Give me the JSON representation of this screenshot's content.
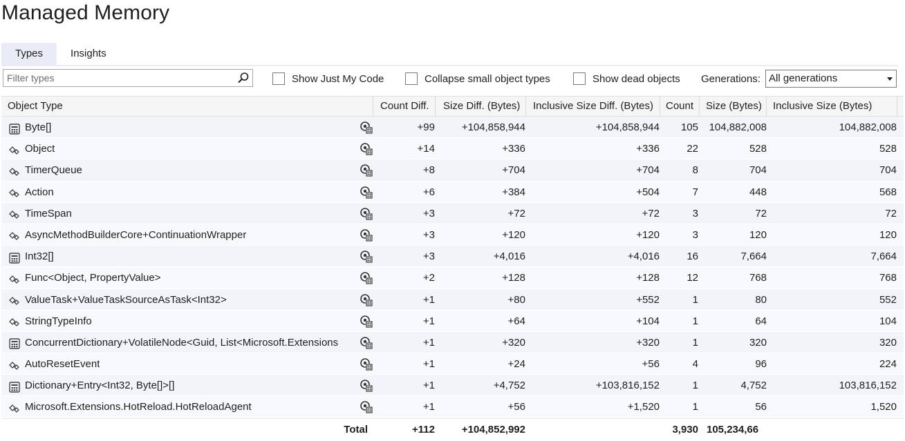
{
  "page": {
    "title": "Managed Memory"
  },
  "tabs": [
    {
      "label": "Types",
      "active": true
    },
    {
      "label": "Insights",
      "active": false
    }
  ],
  "toolbar": {
    "filter_placeholder": "Filter types",
    "filter_value": "",
    "show_just_my_code": {
      "label": "Show Just My Code",
      "checked": false
    },
    "collapse_small": {
      "label": "Collapse small object types",
      "checked": false
    },
    "show_dead": {
      "label": "Show dead objects",
      "checked": false
    },
    "generations_label": "Generations:",
    "generations_value": "All generations"
  },
  "table": {
    "columns": [
      "Object Type",
      "Count Diff.",
      "Size Diff. (Bytes)",
      "Inclusive Size Diff. (Bytes)",
      "Count",
      "Size (Bytes)",
      "Inclusive Size (Bytes)"
    ],
    "rows": [
      {
        "icon": "array-icon",
        "type": "Byte[]",
        "count_diff": "+99",
        "size_diff": "+104,858,944",
        "incl_size_diff": "+104,858,944",
        "count": "105",
        "size": "104,882,008",
        "incl_size": "104,882,008"
      },
      {
        "icon": "class-icon",
        "type": "Object",
        "count_diff": "+14",
        "size_diff": "+336",
        "incl_size_diff": "+336",
        "count": "22",
        "size": "528",
        "incl_size": "528"
      },
      {
        "icon": "class-icon",
        "type": "TimerQueue",
        "count_diff": "+8",
        "size_diff": "+704",
        "incl_size_diff": "+704",
        "count": "8",
        "size": "704",
        "incl_size": "704"
      },
      {
        "icon": "class-icon",
        "type": "Action",
        "count_diff": "+6",
        "size_diff": "+384",
        "incl_size_diff": "+504",
        "count": "7",
        "size": "448",
        "incl_size": "568"
      },
      {
        "icon": "class-icon",
        "type": "TimeSpan",
        "count_diff": "+3",
        "size_diff": "+72",
        "incl_size_diff": "+72",
        "count": "3",
        "size": "72",
        "incl_size": "72"
      },
      {
        "icon": "class-icon",
        "type": "AsyncMethodBuilderCore+ContinuationWrapper",
        "count_diff": "+3",
        "size_diff": "+120",
        "incl_size_diff": "+120",
        "count": "3",
        "size": "120",
        "incl_size": "120"
      },
      {
        "icon": "array-icon",
        "type": "Int32[]",
        "count_diff": "+3",
        "size_diff": "+4,016",
        "incl_size_diff": "+4,016",
        "count": "16",
        "size": "7,664",
        "incl_size": "7,664"
      },
      {
        "icon": "class-icon",
        "type": "Func<Object, PropertyValue>",
        "count_diff": "+2",
        "size_diff": "+128",
        "incl_size_diff": "+128",
        "count": "12",
        "size": "768",
        "incl_size": "768"
      },
      {
        "icon": "class-icon",
        "type": "ValueTask+ValueTaskSourceAsTask<Int32>",
        "count_diff": "+1",
        "size_diff": "+80",
        "incl_size_diff": "+552",
        "count": "1",
        "size": "80",
        "incl_size": "552"
      },
      {
        "icon": "class-icon",
        "type": "StringTypeInfo",
        "count_diff": "+1",
        "size_diff": "+64",
        "incl_size_diff": "+104",
        "count": "1",
        "size": "64",
        "incl_size": "104"
      },
      {
        "icon": "array-icon",
        "type": "ConcurrentDictionary+VolatileNode<Guid, List<Microsoft.Extensions",
        "count_diff": "+1",
        "size_diff": "+320",
        "incl_size_diff": "+320",
        "count": "1",
        "size": "320",
        "incl_size": "320"
      },
      {
        "icon": "class-icon",
        "type": "AutoResetEvent",
        "count_diff": "+1",
        "size_diff": "+24",
        "incl_size_diff": "+56",
        "count": "4",
        "size": "96",
        "incl_size": "224"
      },
      {
        "icon": "array-icon",
        "type": "Dictionary+Entry<Int32, Byte[]>[]",
        "count_diff": "+1",
        "size_diff": "+4,752",
        "incl_size_diff": "+103,816,152",
        "count": "1",
        "size": "4,752",
        "incl_size": "103,816,152"
      },
      {
        "icon": "class-icon",
        "type": "Microsoft.Extensions.HotReload.HotReloadAgent",
        "count_diff": "+1",
        "size_diff": "+56",
        "incl_size_diff": "+1,520",
        "count": "1",
        "size": "56",
        "incl_size": "1,520"
      }
    ],
    "total": {
      "label": "Total",
      "count_diff": "+112",
      "size_diff": "+104,852,992",
      "count": "3,930",
      "size": "105,234,66"
    }
  },
  "colors": {
    "row_alt": "#f2f4fa",
    "tab_active": "#e9ecf6",
    "header_bg": "#f5f5f5"
  }
}
